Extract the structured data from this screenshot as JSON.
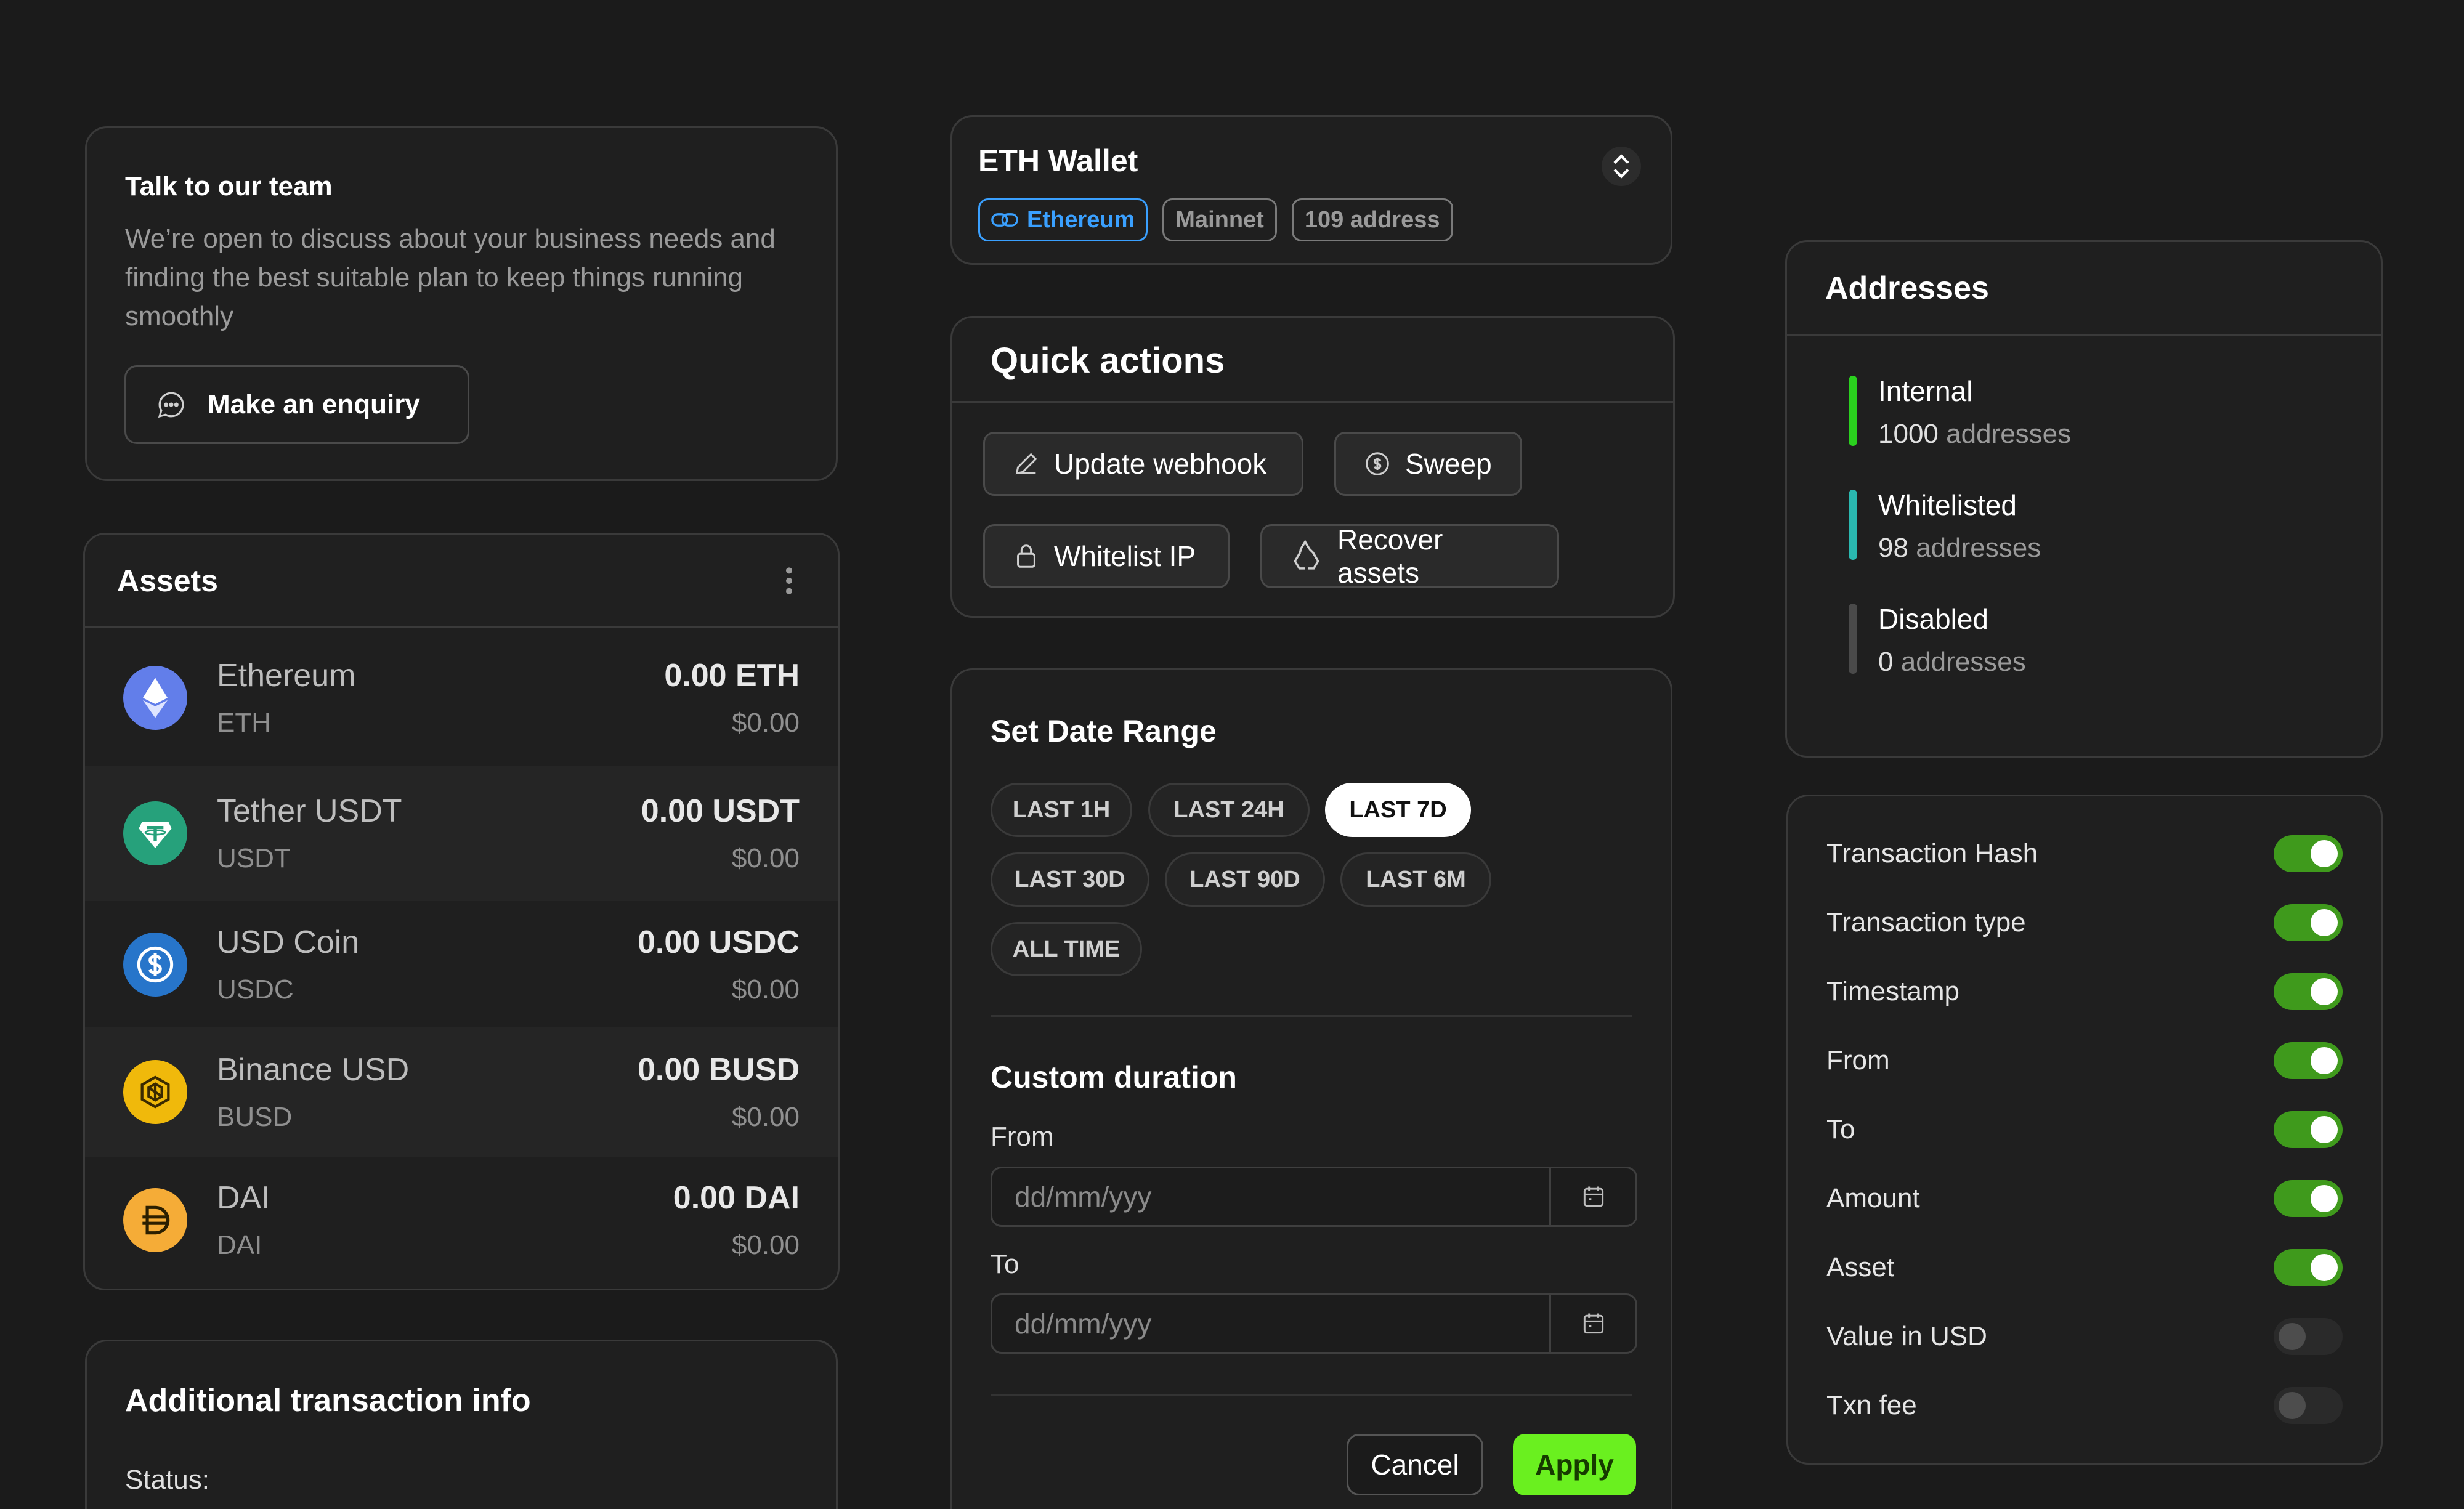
{
  "talk": {
    "title": "Talk to our team",
    "description": "We’re open to discuss about your business needs and finding the best suitable plan to keep things running smoothly",
    "button_label": "Make an enquiry"
  },
  "assets": {
    "title": "Assets",
    "rows": [
      {
        "name": "Ethereum",
        "symbol": "ETH",
        "amount": "0.00 ETH",
        "usd": "$0.00",
        "icon": "ethereum-icon",
        "color": "#627eea"
      },
      {
        "name": "Tether USDT",
        "symbol": "USDT",
        "amount": "0.00 USDT",
        "usd": "$0.00",
        "icon": "tether-icon",
        "color": "#26a17b"
      },
      {
        "name": "USD Coin",
        "symbol": "USDC",
        "amount": "0.00 USDC",
        "usd": "$0.00",
        "icon": "usd-coin-icon",
        "color": "#2775ca"
      },
      {
        "name": "Binance USD",
        "symbol": "BUSD",
        "amount": "0.00 BUSD",
        "usd": "$0.00",
        "icon": "binance-usd-icon",
        "color": "#f0b90b"
      },
      {
        "name": "DAI",
        "symbol": "DAI",
        "amount": "0.00 DAI",
        "usd": "$0.00",
        "icon": "dai-icon",
        "color": "#f5ac37"
      }
    ]
  },
  "additional": {
    "title": "Additional transaction info",
    "status_label": "Status:"
  },
  "wallet": {
    "title": "ETH Wallet",
    "tags": [
      "Ethereum",
      "Mainnet",
      "109 address"
    ]
  },
  "quick_actions": {
    "title": "Quick actions",
    "buttons": [
      "Update webhook",
      "Sweep",
      "Whitelist IP",
      "Recover assets"
    ]
  },
  "date_range": {
    "title": "Set Date Range",
    "presets": [
      "LAST 1H",
      "LAST 24H",
      "LAST 7D",
      "LAST 30D",
      "LAST 90D",
      "LAST 6M",
      "ALL TIME"
    ],
    "active": "LAST 7D",
    "custom_title": "Custom duration",
    "from_label": "From",
    "to_label": "To",
    "placeholder": "dd/mm/yyy",
    "cancel_label": "Cancel",
    "apply_label": "Apply"
  },
  "addresses": {
    "title": "Addresses",
    "items": [
      {
        "name": "Internal",
        "count": "1000",
        "unit": "addresses",
        "color": "#2ad11e"
      },
      {
        "name": "Whitelisted",
        "count": "98",
        "unit": "addresses",
        "color": "#2ab8b0"
      },
      {
        "name": "Disabled",
        "count": "0",
        "unit": "addresses",
        "color": "#4a4a4a"
      }
    ]
  },
  "columns": {
    "items": [
      {
        "label": "Transaction Hash",
        "on": true
      },
      {
        "label": "Transaction type",
        "on": true
      },
      {
        "label": "Timestamp",
        "on": true
      },
      {
        "label": "From",
        "on": true
      },
      {
        "label": "To",
        "on": true
      },
      {
        "label": "Amount",
        "on": true
      },
      {
        "label": "Asset",
        "on": true
      },
      {
        "label": "Value in USD",
        "on": false
      },
      {
        "label": "Txn fee",
        "on": false
      }
    ]
  }
}
